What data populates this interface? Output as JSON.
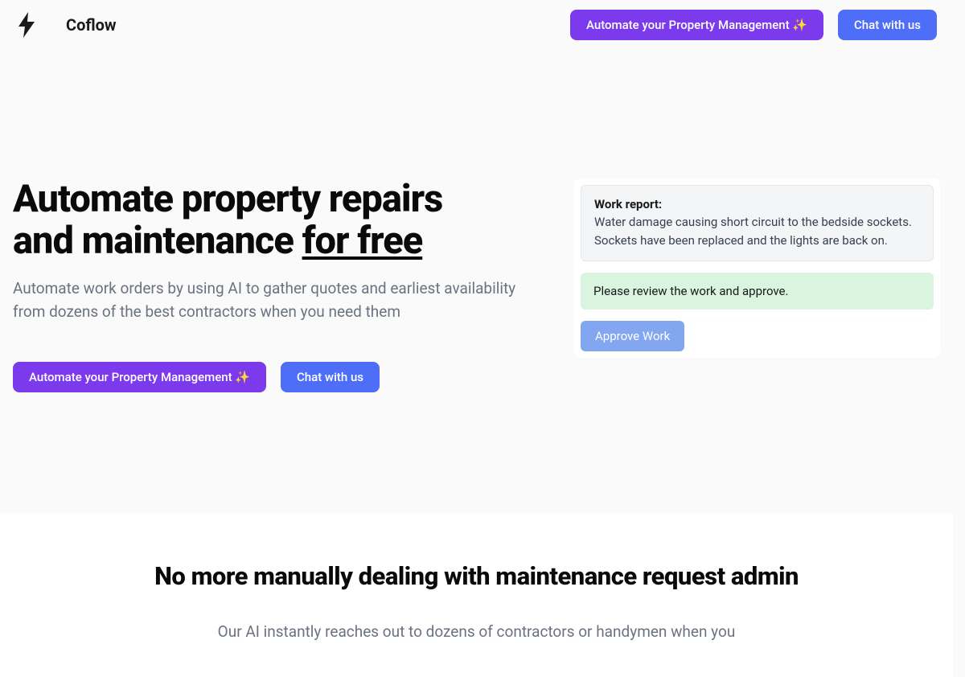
{
  "brand": {
    "name": "Coflow"
  },
  "header": {
    "automate_label": "Automate your Property Management ✨",
    "chat_label": "Chat with us"
  },
  "hero": {
    "title_line1": "Automate property repairs",
    "title_line2_prefix": "and maintenance ",
    "title_line2_underline": "for free",
    "subtitle": "Automate work orders by using AI to gather quotes and earliest availability from dozens of the best contractors when you need them",
    "automate_label": "Automate your Property Management ✨",
    "chat_label": "Chat with us"
  },
  "widget": {
    "report_label": "Work report:",
    "report_text": "Water damage causing short circuit to the bedside sockets. Sockets have been replaced and the lights are back on.",
    "review_text": "Please review the work and approve.",
    "approve_label": "Approve Work"
  },
  "section2": {
    "title": "No more manually dealing with maintenance request admin",
    "text": "Our AI instantly reaches out to dozens of contractors or handymen when you"
  }
}
